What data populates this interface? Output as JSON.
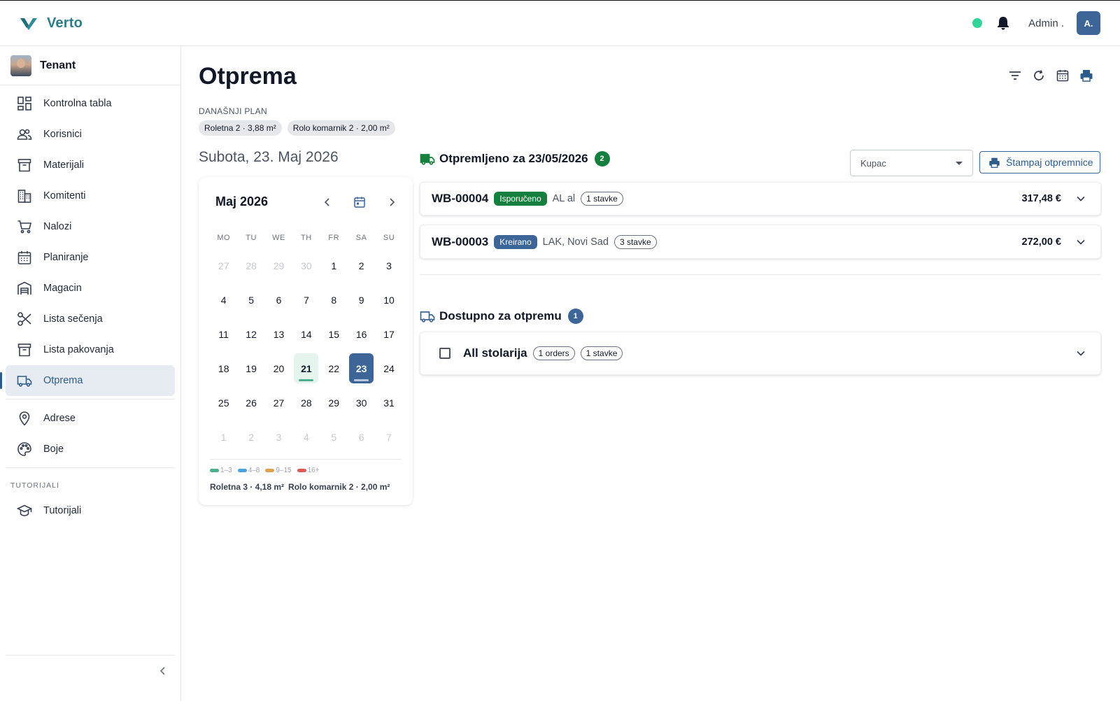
{
  "app": {
    "brand": "Verto",
    "admin_name": "Admin .",
    "avatar_initials": "A.",
    "online_color": "#34d399"
  },
  "sidebar": {
    "tenant": "Tenant",
    "items": [
      {
        "label": "Kontrolna tabla",
        "icon": "dashboard-icon"
      },
      {
        "label": "Korisnici",
        "icon": "users-icon"
      },
      {
        "label": "Materijali",
        "icon": "archive-box-icon"
      },
      {
        "label": "Komitenti",
        "icon": "building-icon"
      },
      {
        "label": "Nalozi",
        "icon": "cart-icon"
      },
      {
        "label": "Planiranje",
        "icon": "calendar-icon"
      },
      {
        "label": "Magacin",
        "icon": "warehouse-icon"
      },
      {
        "label": "Lista sečenja",
        "icon": "scissors-icon"
      },
      {
        "label": "Lista pakovanja",
        "icon": "archive-box-icon"
      },
      {
        "label": "Otprema",
        "icon": "truck-icon",
        "active": true
      }
    ],
    "items2": [
      {
        "label": "Adrese",
        "icon": "location-pin-icon"
      },
      {
        "label": "Boje",
        "icon": "palette-icon"
      }
    ],
    "section_label": "TUTORIJALI",
    "tutorial_item": {
      "label": "Tutorijali",
      "icon": "graduation-cap-icon"
    }
  },
  "page": {
    "title": "Otprema",
    "plan_label": "DANAŠNJI PLAN",
    "plan_chips": [
      "Roletna 2 · 3,88 m²",
      "Rolo komarnik 2 · 2,00 m²"
    ],
    "date_heading": "Subota, 23. Maj 2026"
  },
  "calendar": {
    "month_label": "Maj 2026",
    "weekdays": [
      "MO",
      "TU",
      "WE",
      "TH",
      "FR",
      "SA",
      "SU"
    ],
    "days": [
      {
        "d": "27",
        "m": true
      },
      {
        "d": "28",
        "m": true
      },
      {
        "d": "29",
        "m": true
      },
      {
        "d": "30",
        "m": true
      },
      {
        "d": "1"
      },
      {
        "d": "2"
      },
      {
        "d": "3"
      },
      {
        "d": "4"
      },
      {
        "d": "5"
      },
      {
        "d": "6"
      },
      {
        "d": "7"
      },
      {
        "d": "8"
      },
      {
        "d": "9"
      },
      {
        "d": "10"
      },
      {
        "d": "11"
      },
      {
        "d": "12"
      },
      {
        "d": "13"
      },
      {
        "d": "14"
      },
      {
        "d": "15"
      },
      {
        "d": "16"
      },
      {
        "d": "17"
      },
      {
        "d": "18"
      },
      {
        "d": "19"
      },
      {
        "d": "20"
      },
      {
        "d": "21",
        "marked": true
      },
      {
        "d": "22"
      },
      {
        "d": "23",
        "selected": true
      },
      {
        "d": "24"
      },
      {
        "d": "25"
      },
      {
        "d": "26"
      },
      {
        "d": "27"
      },
      {
        "d": "28"
      },
      {
        "d": "29"
      },
      {
        "d": "30"
      },
      {
        "d": "31"
      },
      {
        "d": "1",
        "m": true
      },
      {
        "d": "2",
        "m": true
      },
      {
        "d": "3",
        "m": true
      },
      {
        "d": "4",
        "m": true
      },
      {
        "d": "5",
        "m": true
      },
      {
        "d": "6",
        "m": true
      },
      {
        "d": "7",
        "m": true
      }
    ],
    "legend": [
      {
        "label": "1–3",
        "color": "#4caf8f"
      },
      {
        "label": "4–8",
        "color": "#4aa3df"
      },
      {
        "label": "9–15",
        "color": "#e0a050"
      },
      {
        "label": "16+",
        "color": "#e05a5a"
      }
    ],
    "summary": [
      "Roletna 3 · 4,18 m²",
      "Rolo komarnik 2 · 2,00 m²"
    ]
  },
  "shipped": {
    "title": "Otpremljeno za 23/05/2026",
    "count": "2",
    "count_color": "#15803d",
    "customer_select": "Kupac",
    "print_label": "Štampaj otpremnice",
    "rows": [
      {
        "code": "WB-00004",
        "status": "Isporučeno",
        "status_color": "#15803d",
        "customer": "AL al",
        "items": "1 stavke",
        "amount": "317,48 €"
      },
      {
        "code": "WB-00003",
        "status": "Kreirano",
        "status_color": "#3d6598",
        "customer": "LAK, Novi Sad",
        "items": "3 stavke",
        "amount": "272,00 €"
      }
    ]
  },
  "available": {
    "title": "Dostupno za otpremu",
    "count": "1",
    "count_color": "#3d6598",
    "group": {
      "name": "All stolarija",
      "orders": "1 orders",
      "items": "1 stavke"
    }
  }
}
